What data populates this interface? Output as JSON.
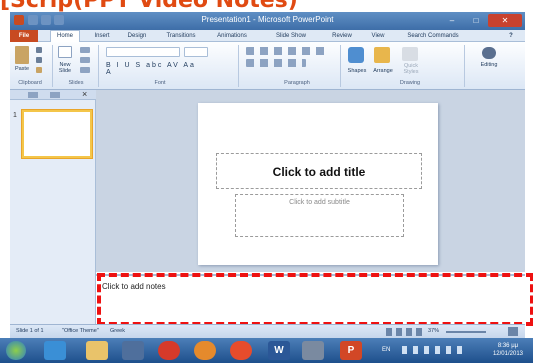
{
  "banner": {
    "text": "[Scrip(PPT Video Notes)"
  },
  "window": {
    "title": "Presentation1 - Microsoft PowerPoint",
    "minimize": "–",
    "maximize": "□",
    "close": "✕"
  },
  "tabs": [
    "File",
    "Home",
    "Insert",
    "Design",
    "Transitions",
    "Animations",
    "Slide Show",
    "Review",
    "View",
    "Search Commands"
  ],
  "ribbon": {
    "paste": "Paste",
    "new_slide": "New\nSlide",
    "shapes": "Shapes",
    "arrange": "Arrange",
    "quick_styles": "Quick\nStyles",
    "editing": "Editing",
    "groups": [
      "Clipboard",
      "Slides",
      "Font",
      "Paragraph",
      "Drawing"
    ]
  },
  "left_pane": {
    "close": "×",
    "slide_number": "1"
  },
  "slide": {
    "title_placeholder": "Click to add title",
    "subtitle_placeholder": "Click to add subtitle"
  },
  "notes": {
    "placeholder": "Click to add notes"
  },
  "status": {
    "slide": "Slide 1 of 1",
    "theme": "\"Office Theme\"",
    "language": "Greek",
    "zoom": "37%"
  },
  "taskbar": {
    "lang": "EN",
    "time": "8:36 μμ",
    "date": "12/01/2013"
  }
}
